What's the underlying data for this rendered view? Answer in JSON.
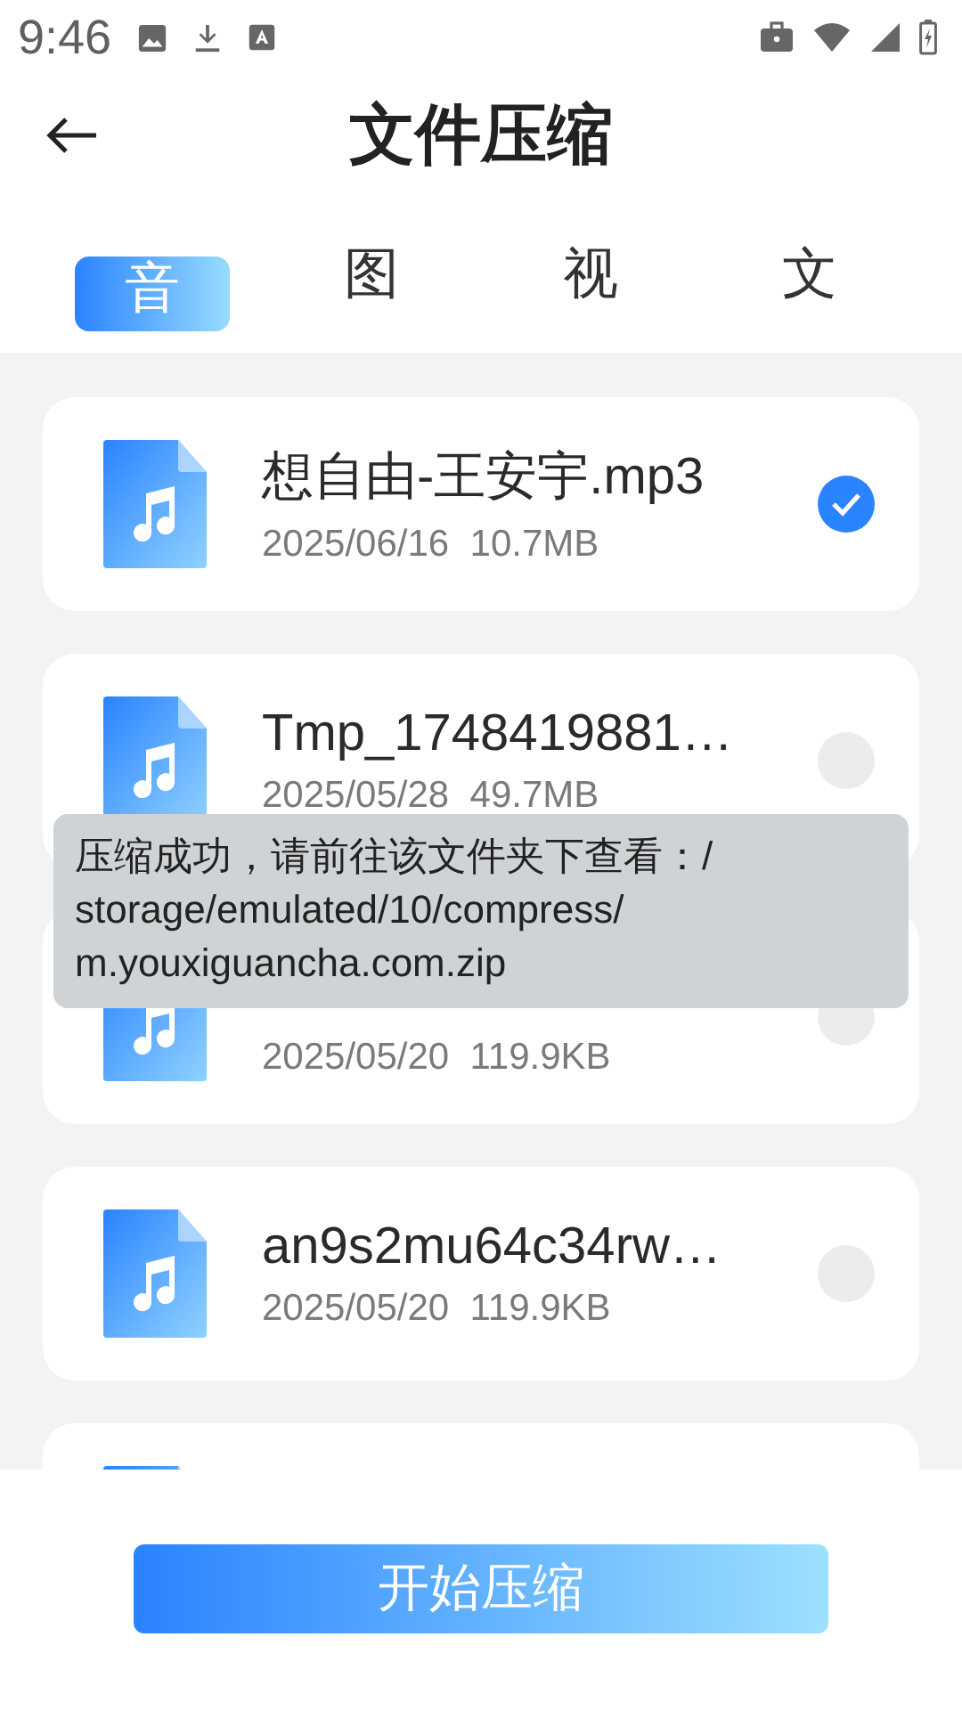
{
  "status_bar": {
    "time": "9:46"
  },
  "header": {
    "title": "文件压缩"
  },
  "tabs": [
    {
      "label": "音",
      "selected": true
    },
    {
      "label": "图",
      "selected": false
    },
    {
      "label": "视",
      "selected": false
    },
    {
      "label": "文",
      "selected": false
    }
  ],
  "files": [
    {
      "kind": "audio",
      "name": "想自由-王安宇.mp3",
      "meta": "2025/06/16  10.7MB",
      "checked": true
    },
    {
      "kind": "audio",
      "name": "Tmp_1748419881…",
      "meta": "2025/05/28  49.7MB",
      "checked": false
    },
    {
      "kind": "audio",
      "meta": "2025/05/20  119.9KB",
      "checked": false
    },
    {
      "kind": "audio",
      "name": "an9s2mu64c34rw…",
      "meta": "2025/05/20  119.9KB",
      "checked": false
    },
    {
      "kind": "audio"
    }
  ],
  "toast": {
    "text": "压缩成功，请前往该文件夹下查看：/storage/emulated/10/compress/m.youxiguancha.com.zip"
  },
  "action_button": {
    "label": "开始压缩"
  }
}
